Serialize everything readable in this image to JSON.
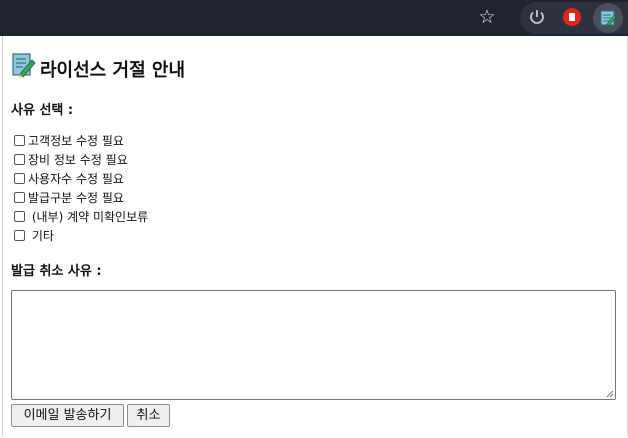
{
  "browser": {
    "star_icon": "☆",
    "extensions": [
      "power-icon",
      "red-bookmark-icon",
      "license-extension-icon"
    ]
  },
  "popup": {
    "title": "라이선스 거절 안내",
    "reason_section_label": "사유 선택 :",
    "reasons": [
      {
        "label": "고객정보 수정 필요",
        "checked": false
      },
      {
        "label": "장비 정보 수정 필요",
        "checked": false
      },
      {
        "label": "사용자수 수정 필요",
        "checked": false
      },
      {
        "label": "발급구분 수정 필요",
        "checked": false
      },
      {
        "label": " (내부) 계약 미확인보류",
        "checked": false
      },
      {
        "label": " 기타",
        "checked": false
      }
    ],
    "cancel_reason_label": "발급 취소 사유 :",
    "memo_value": "",
    "send_button": "이메일 발송하기",
    "cancel_button": "취소"
  }
}
